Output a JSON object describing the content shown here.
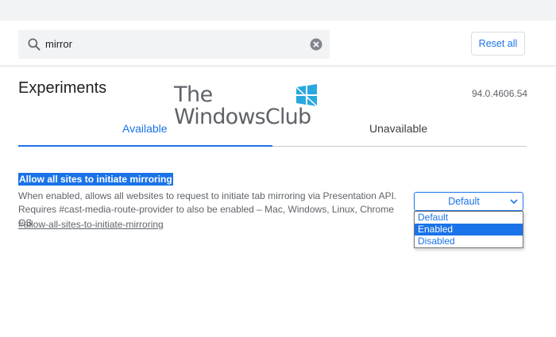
{
  "search": {
    "value": "mirror"
  },
  "header": {
    "reset_label": "Reset all"
  },
  "page": {
    "title": "Experiments",
    "version": "94.0.4606.54"
  },
  "watermark": {
    "line1": "The",
    "line2": "WindowsClub"
  },
  "tabs": [
    {
      "label": "Available",
      "active": true
    },
    {
      "label": "Unavailable",
      "active": false
    }
  ],
  "flag": {
    "title": "Allow all sites to initiate mirroring",
    "description_line1": "When enabled, allows all websites to request to initiate tab mirroring via Presentation API.",
    "description_line2": "Requires #cast-media-route-provider to also be enabled – Mac, Windows, Linux, Chrome OS",
    "link": "#allow-all-sites-to-initiate-mirroring",
    "select_value": "Default",
    "options": [
      "Default",
      "Enabled",
      "Disabled"
    ],
    "highlighted_option": "Enabled"
  },
  "colors": {
    "accent": "#1a73e8",
    "text": "#202124",
    "muted": "#5f6368"
  },
  "icons": {
    "search": "search-icon",
    "clear": "clear-icon",
    "dropdown": "chevron-down-icon"
  }
}
